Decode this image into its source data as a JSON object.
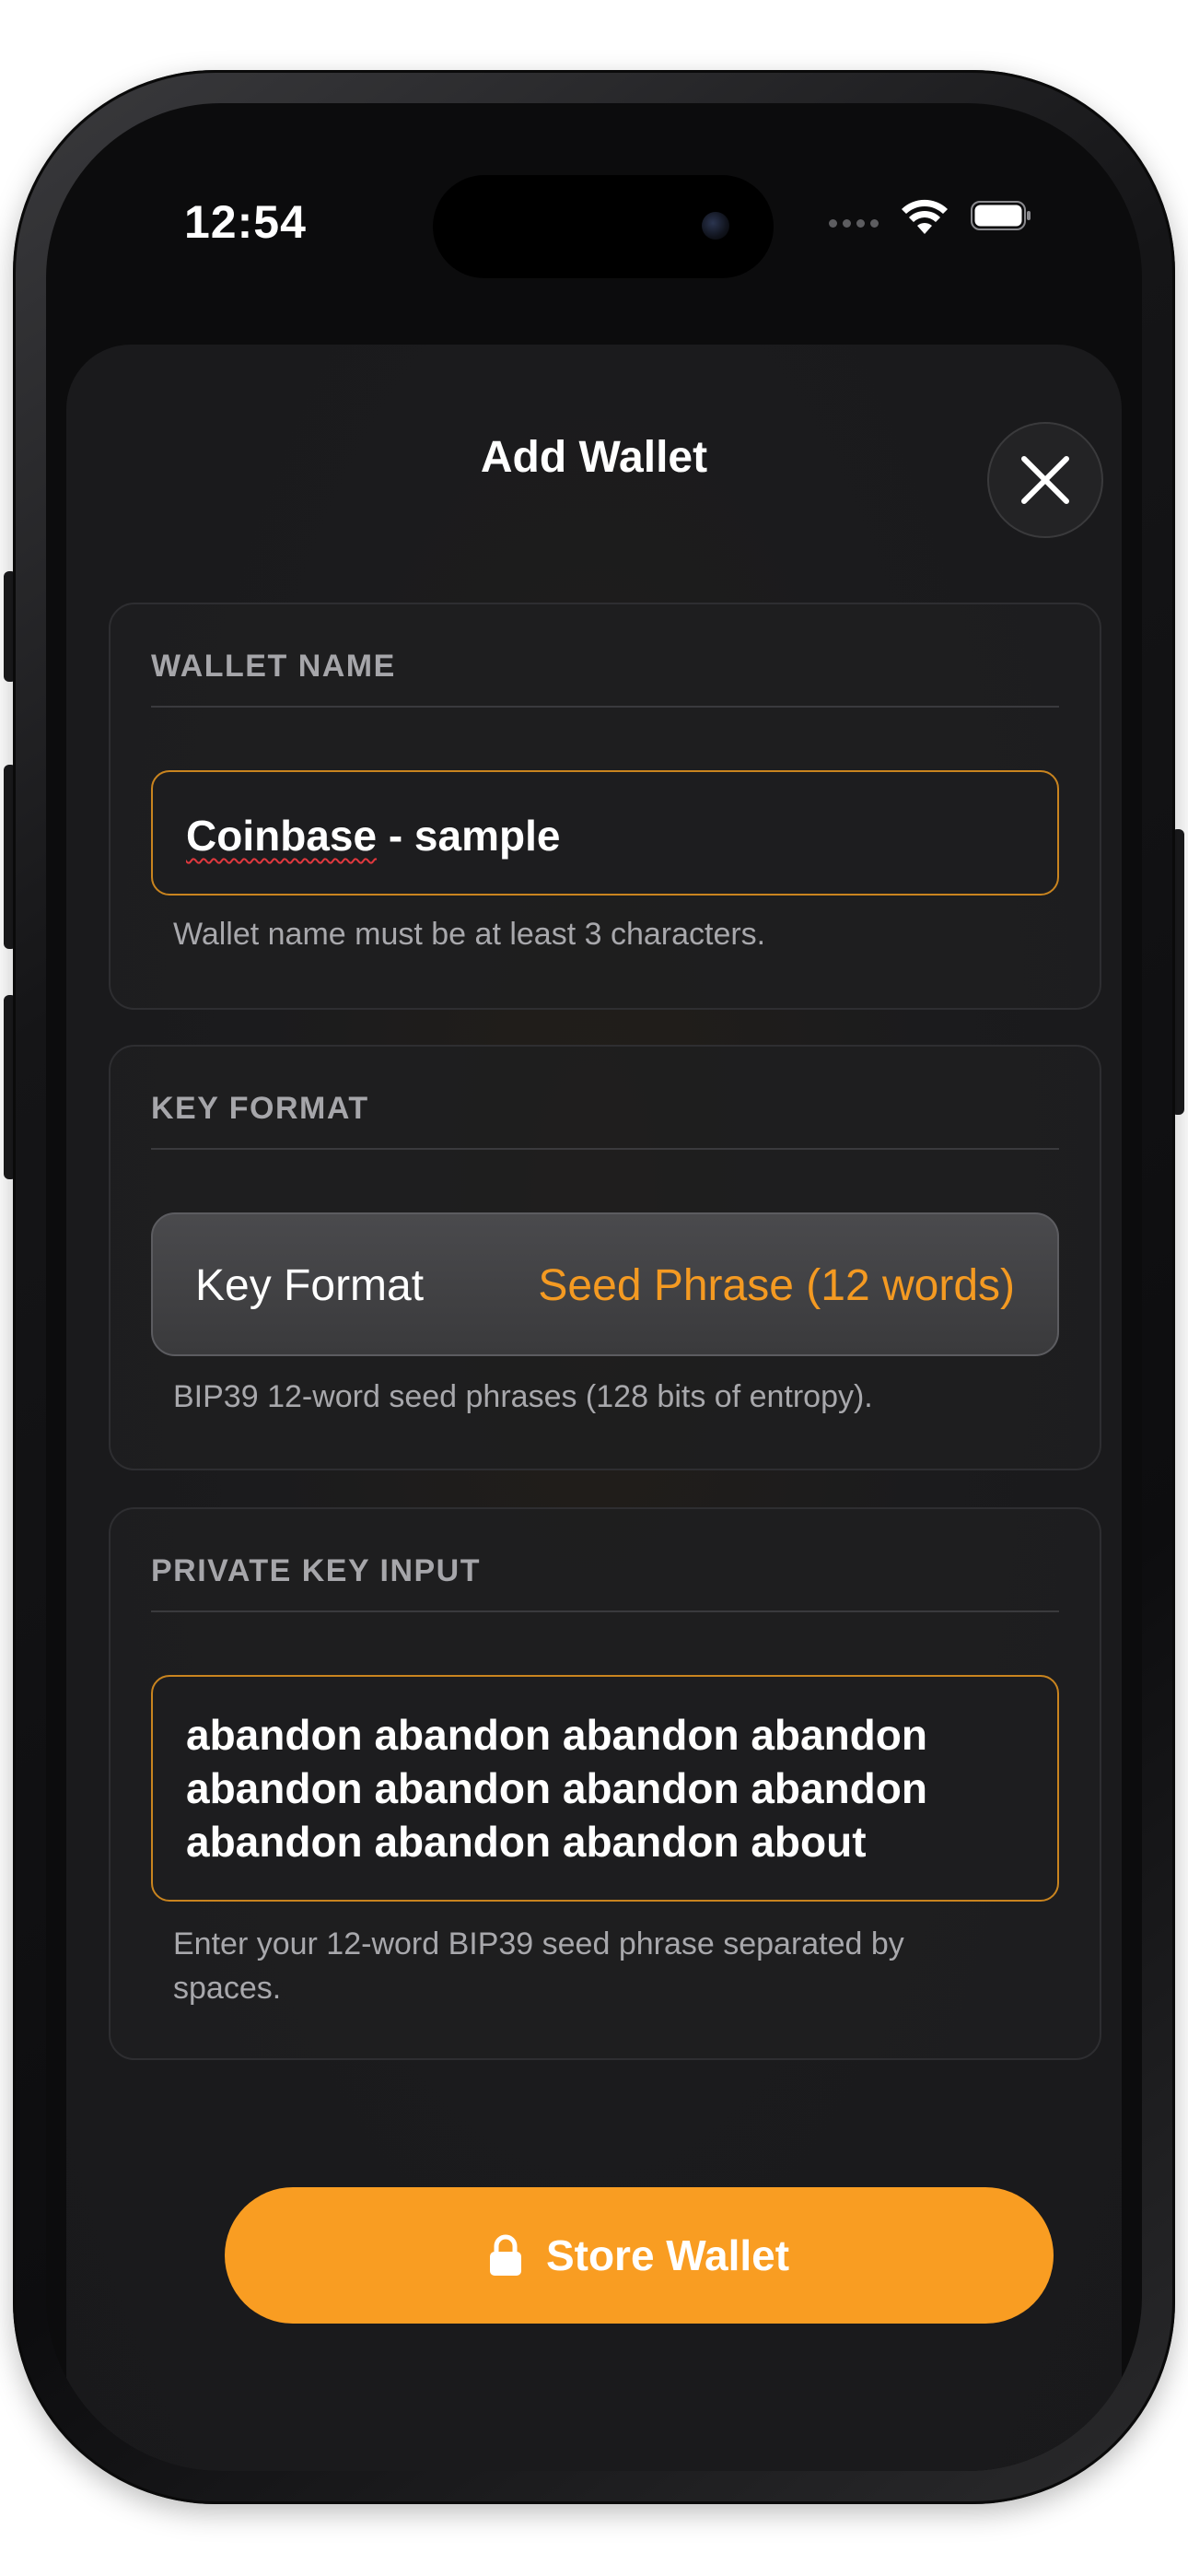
{
  "status_bar": {
    "time": "12:54"
  },
  "icons": {
    "wifi": "wifi-icon",
    "battery": "battery-icon",
    "close": "close-icon",
    "lock": "lock-icon"
  },
  "colors": {
    "accent": "#f99d22",
    "field_border": "#c9841f",
    "background": "#1b1b1d",
    "error_underline": "#e0383e"
  },
  "sheet": {
    "title": "Add Wallet"
  },
  "wallet_name": {
    "header": "WALLET NAME",
    "value_part1": "Coinbase",
    "value_part2": " - sample",
    "helper": "Wallet name must be at least 3 characters."
  },
  "key_format": {
    "header": "KEY FORMAT",
    "picker_label": "Key Format",
    "picker_value": "Seed Phrase (12 words)",
    "helper": "BIP39 12-word seed phrases (128 bits of entropy)."
  },
  "private_key": {
    "header": "PRIVATE KEY INPUT",
    "value": "abandon abandon abandon abandon abandon abandon abandon abandon abandon abandon abandon about",
    "helper": "Enter your 12-word BIP39 seed phrase separated by spaces."
  },
  "actions": {
    "store_label": "Store Wallet"
  }
}
